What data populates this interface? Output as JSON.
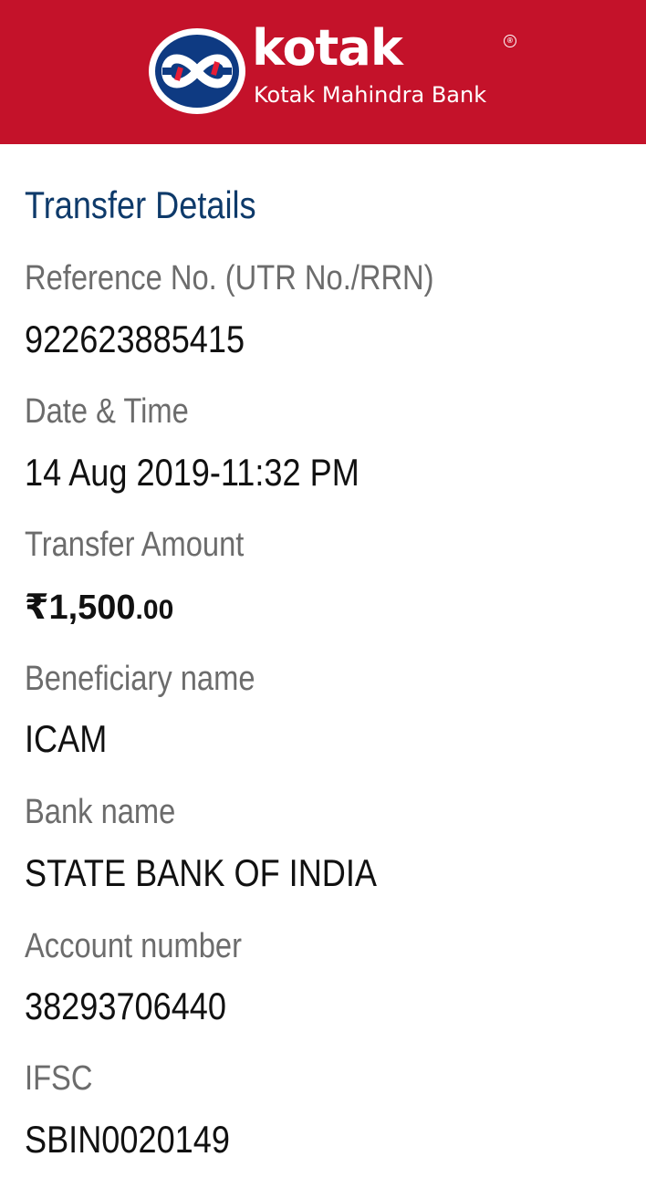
{
  "header": {
    "brand_name": "kotak",
    "brand_subtitle": "Kotak Mahindra Bank",
    "registered_mark": "®",
    "brand_color": "#c4122a",
    "logo_icon": "kotak-infinity-logo-icon"
  },
  "transfer_details": {
    "title": "Transfer Details",
    "reference_label": "Reference No. (UTR No./RRN)",
    "reference_value": "922623885415",
    "datetime_label": "Date & Time",
    "datetime_value": "14 Aug 2019-11:32 PM",
    "amount_label": "Transfer Amount",
    "amount_currency": "₹",
    "amount_main": "1,500",
    "amount_paise": ".00",
    "beneficiary_label": "Beneficiary name",
    "beneficiary_value": "ICAM",
    "bank_label": "Bank name",
    "bank_value": "STATE BANK OF INDIA",
    "account_label": "Account number",
    "account_value": "38293706440",
    "ifsc_label": "IFSC",
    "ifsc_value": "SBIN0020149"
  },
  "colors": {
    "title": "#0e3a6a",
    "label": "#6c6c6c",
    "value": "#111111"
  }
}
